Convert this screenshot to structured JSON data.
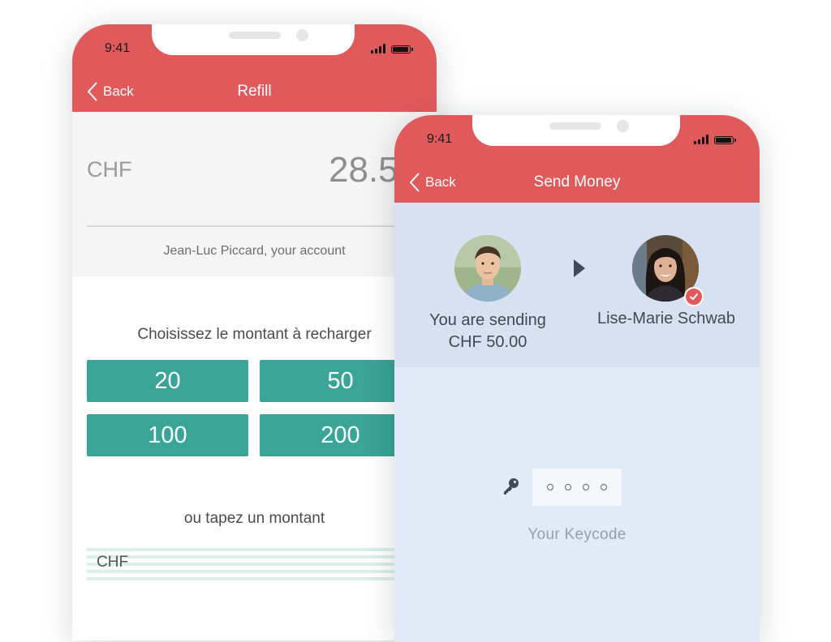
{
  "left_phone": {
    "status_time": "9:41",
    "back_label": "Back",
    "title": "Refill",
    "currency": "CHF",
    "amount": "28.50",
    "account_text": "Jean-Luc Piccard, your account",
    "choose_label": "Choisissez le montant à recharger",
    "amount_options": [
      "20",
      "50",
      "100",
      "200"
    ],
    "or_label": "ou tapez un montant",
    "custom_amount_prefix": "CHF"
  },
  "right_phone": {
    "status_time": "9:41",
    "back_label": "Back",
    "title": "Send Money",
    "sending_line1": "You are sending",
    "sending_line2": "CHF 50.00",
    "recipient_name": "Lise-Marie Schwab",
    "keycode_label": "Your  Keycode"
  },
  "colors": {
    "header": "#e05a5c",
    "amount_button": "#3aa497",
    "transfer_bg": "#d6e1f1",
    "body_bg": "#e1eaf7"
  }
}
